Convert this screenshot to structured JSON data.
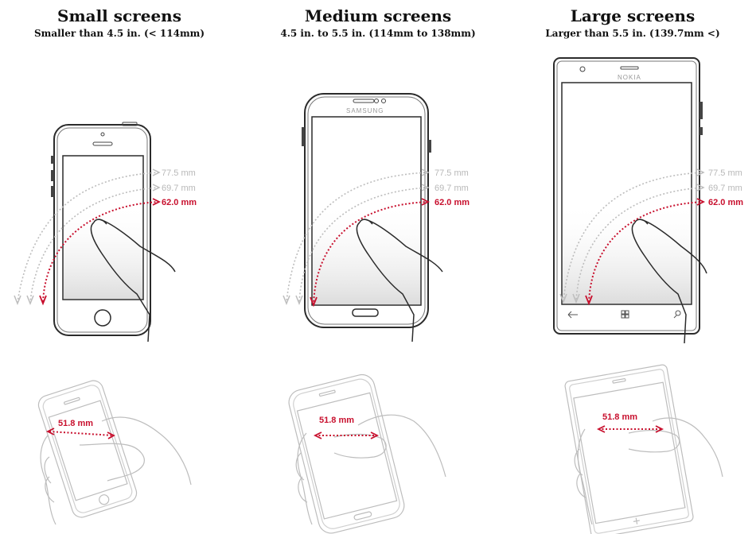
{
  "columns": [
    {
      "title": "Small screens",
      "subtitle": "Smaller than 4.5 in. (< 114mm)"
    },
    {
      "title": "Medium screens",
      "subtitle": "4.5 in. to 5.5 in. (114mm to 138mm)"
    },
    {
      "title": "Large screens",
      "subtitle": "Larger than 5.5 in. (139.7mm <)"
    }
  ],
  "reach_labels": [
    "77.5 mm",
    "69.7 mm",
    "62.0 mm"
  ],
  "grip_label": "51.8 mm",
  "brands": {
    "medium": "SAMSUNG",
    "large": "NOKIA"
  },
  "colors": {
    "accent": "#c8102e",
    "outline": "#2b2b2b",
    "faint": "#bdbdbd"
  }
}
